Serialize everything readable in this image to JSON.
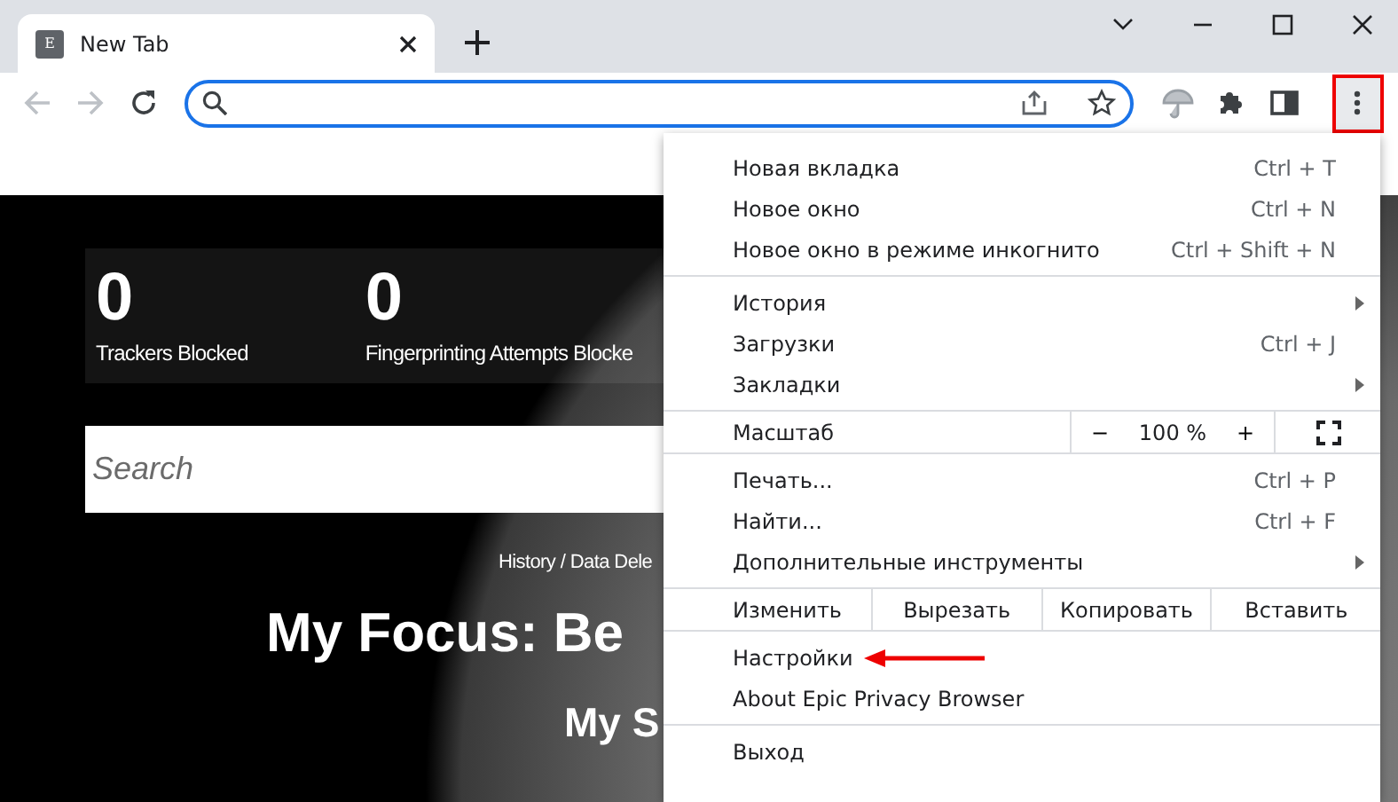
{
  "tab": {
    "favicon": "E",
    "title": "New Tab",
    "selected": true
  },
  "toolbar": {
    "back_disabled": true,
    "forward_disabled": true,
    "menu_button_highlighted": true
  },
  "page": {
    "stats": [
      {
        "value": "0",
        "label": "Trackers Blocked"
      },
      {
        "value": "0",
        "label": "Fingerprinting Attempts Blocke"
      }
    ],
    "search": {
      "placeholder": "Search"
    },
    "history_link": "History / Data Dele",
    "focus_title": "My Focus: Be",
    "subtitle": "My S"
  },
  "menu": {
    "sections": [
      {
        "items": [
          {
            "kind": "command",
            "label": "Новая вкладка",
            "shortcut": "Ctrl + T",
            "submenu": false
          },
          {
            "kind": "command",
            "label": "Новое окно",
            "shortcut": "Ctrl + N",
            "submenu": false
          },
          {
            "kind": "command",
            "label": "Новое окно в режиме инкогнито",
            "shortcut": "Ctrl + Shift + N",
            "submenu": false
          }
        ]
      },
      {
        "items": [
          {
            "kind": "command",
            "label": "История",
            "submenu": true
          },
          {
            "kind": "command",
            "label": "Загрузки",
            "shortcut": "Ctrl + J",
            "submenu": false
          },
          {
            "kind": "command",
            "label": "Закладки",
            "submenu": true
          }
        ]
      },
      {
        "items": [
          {
            "kind": "zoom",
            "label": "Масштаб",
            "minus": "−",
            "value": "100 %",
            "plus": "+"
          }
        ]
      },
      {
        "items": [
          {
            "kind": "command",
            "label": "Печать...",
            "shortcut": "Ctrl + P",
            "submenu": false
          },
          {
            "kind": "command",
            "label": "Найти...",
            "shortcut": "Ctrl + F",
            "submenu": false
          },
          {
            "kind": "command",
            "label": "Дополнительные инструменты",
            "submenu": true
          }
        ]
      },
      {
        "items": [
          {
            "kind": "edit",
            "label": "Изменить",
            "buttons": [
              "Вырезать",
              "Копировать",
              "Вставить"
            ]
          }
        ]
      },
      {
        "items": [
          {
            "kind": "command",
            "label": "Настройки",
            "submenu": false,
            "arrow": true
          },
          {
            "kind": "command",
            "label": "About Epic Privacy Browser",
            "submenu": false,
            "arrow": false
          }
        ]
      },
      {
        "items": [
          {
            "kind": "command",
            "label": "Выход",
            "submenu": false
          }
        ]
      }
    ]
  }
}
